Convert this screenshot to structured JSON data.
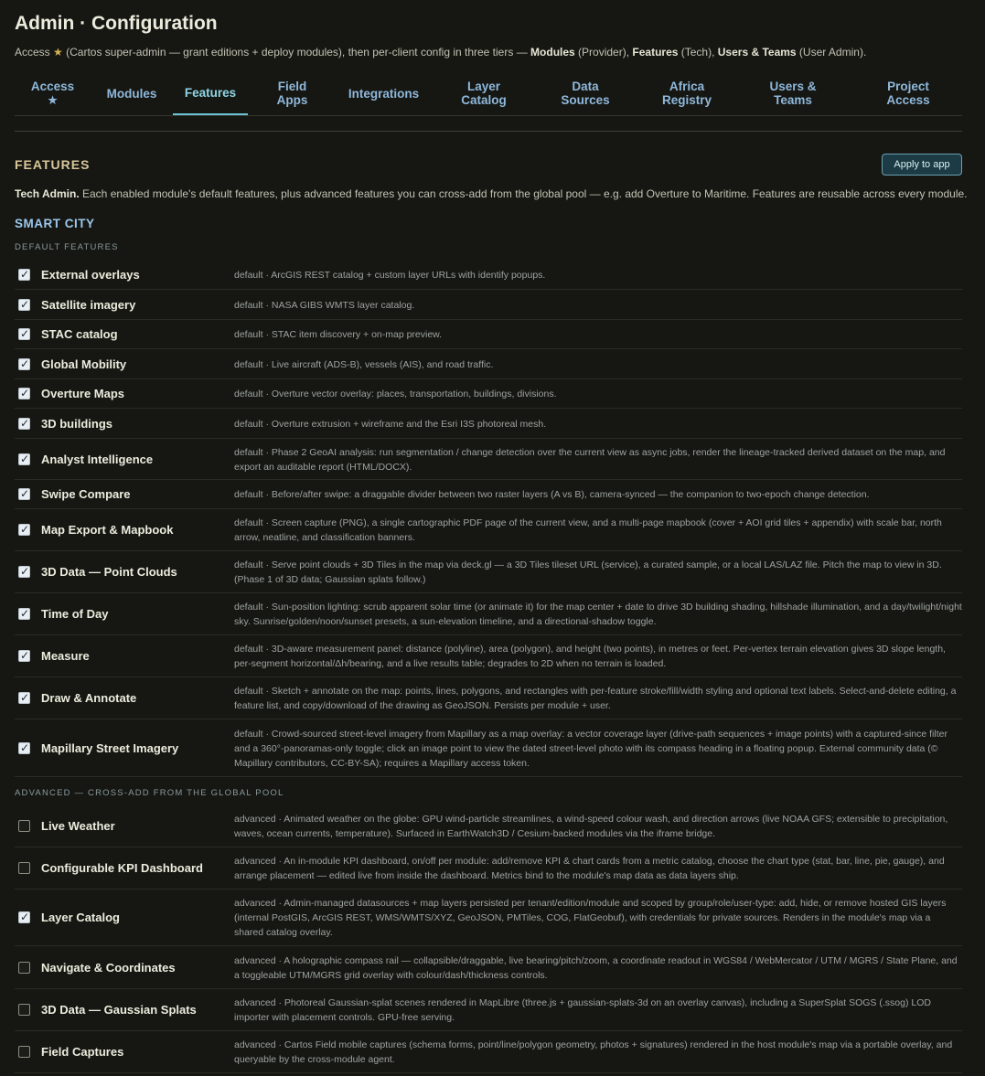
{
  "header": {
    "title": "Admin · Configuration",
    "subtitle_parts": [
      "Access ",
      "★",
      " (Cartos super-admin — grant editions + deploy modules), then per-client config in three tiers — ",
      "Modules",
      " (Provider), ",
      "Features",
      " (Tech), ",
      "Users & Teams",
      " (User Admin)."
    ]
  },
  "tabs": [
    {
      "label": "Access\n★",
      "active": false
    },
    {
      "label": "Modules",
      "active": false
    },
    {
      "label": "Features",
      "active": true
    },
    {
      "label": "Field\nApps",
      "active": false
    },
    {
      "label": "Integrations",
      "active": false
    },
    {
      "label": "Layer\nCatalog",
      "active": false
    },
    {
      "label": "Data\nSources",
      "active": false
    },
    {
      "label": "Africa\nRegistry",
      "active": false
    },
    {
      "label": "Users &\nTeams",
      "active": false
    },
    {
      "label": "Project\nAccess",
      "active": false
    }
  ],
  "section": {
    "title": "FEATURES",
    "apply_label": "Apply to app",
    "intro_bold": "Tech Admin.",
    "intro_text": " Each enabled module's default features, plus advanced features you can cross-add from the global pool — e.g. add Overture to Maritime. Features are reusable across every module."
  },
  "module": {
    "title": "SMART CITY",
    "default_label": "DEFAULT FEATURES",
    "advanced_label": "ADVANCED — CROSS-ADD FROM THE GLOBAL POOL"
  },
  "default_features": [
    {
      "name": "External overlays",
      "checked": true,
      "desc": "default · ArcGIS REST catalog + custom layer URLs with identify popups."
    },
    {
      "name": "Satellite imagery",
      "checked": true,
      "desc": "default · NASA GIBS WMTS layer catalog."
    },
    {
      "name": "STAC catalog",
      "checked": true,
      "desc": "default · STAC item discovery + on-map preview."
    },
    {
      "name": "Global Mobility",
      "checked": true,
      "desc": "default · Live aircraft (ADS-B), vessels (AIS), and road traffic."
    },
    {
      "name": "Overture Maps",
      "checked": true,
      "desc": "default · Overture vector overlay: places, transportation, buildings, divisions."
    },
    {
      "name": "3D buildings",
      "checked": true,
      "desc": "default · Overture extrusion + wireframe and the Esri I3S photoreal mesh."
    },
    {
      "name": "Analyst Intelligence",
      "checked": true,
      "desc": "default · Phase 2 GeoAI analysis: run segmentation / change detection over the current view as async jobs, render the lineage-tracked derived dataset on the map, and export an auditable report (HTML/DOCX)."
    },
    {
      "name": "Swipe Compare",
      "checked": true,
      "desc": "default · Before/after swipe: a draggable divider between two raster layers (A vs B), camera-synced — the companion to two-epoch change detection."
    },
    {
      "name": "Map Export & Mapbook",
      "checked": true,
      "desc": "default · Screen capture (PNG), a single cartographic PDF page of the current view, and a multi-page mapbook (cover + AOI grid tiles + appendix) with scale bar, north arrow, neatline, and classification banners."
    },
    {
      "name": "3D Data — Point Clouds",
      "checked": true,
      "desc": "default · Serve point clouds + 3D Tiles in the map via deck.gl — a 3D Tiles tileset URL (service), a curated sample, or a local LAS/LAZ file. Pitch the map to view in 3D. (Phase 1 of 3D data; Gaussian splats follow.)"
    },
    {
      "name": "Time of Day",
      "checked": true,
      "desc": "default · Sun-position lighting: scrub apparent solar time (or animate it) for the map center + date to drive 3D building shading, hillshade illumination, and a day/twilight/night sky. Sunrise/golden/noon/sunset presets, a sun-elevation timeline, and a directional-shadow toggle."
    },
    {
      "name": "Measure",
      "checked": true,
      "desc": "default · 3D-aware measurement panel: distance (polyline), area (polygon), and height (two points), in metres or feet. Per-vertex terrain elevation gives 3D slope length, per-segment horizontal/Δh/bearing, and a live results table; degrades to 2D when no terrain is loaded."
    },
    {
      "name": "Draw & Annotate",
      "checked": true,
      "desc": "default · Sketch + annotate on the map: points, lines, polygons, and rectangles with per-feature stroke/fill/width styling and optional text labels. Select-and-delete editing, a feature list, and copy/download of the drawing as GeoJSON. Persists per module + user."
    },
    {
      "name": "Mapillary Street Imagery",
      "checked": true,
      "desc": "default · Crowd-sourced street-level imagery from Mapillary as a map overlay: a vector coverage layer (drive-path sequences + image points) with a captured-since filter and a 360°-panoramas-only toggle; click an image point to view the dated street-level photo with its compass heading in a floating popup. External community data (© Mapillary contributors, CC-BY-SA); requires a Mapillary access token."
    }
  ],
  "advanced_features": [
    {
      "name": "Live Weather",
      "checked": false,
      "desc": "advanced · Animated weather on the globe: GPU wind-particle streamlines, a wind-speed colour wash, and direction arrows (live NOAA GFS; extensible to precipitation, waves, ocean currents, temperature). Surfaced in EarthWatch3D / Cesium-backed modules via the iframe bridge."
    },
    {
      "name": "Configurable KPI Dashboard",
      "checked": false,
      "desc": "advanced · An in-module KPI dashboard, on/off per module: add/remove KPI & chart cards from a metric catalog, choose the chart type (stat, bar, line, pie, gauge), and arrange placement — edited live from inside the dashboard. Metrics bind to the module's map data as data layers ship."
    },
    {
      "name": "Layer Catalog",
      "checked": true,
      "desc": "advanced · Admin-managed datasources + map layers persisted per tenant/edition/module and scoped by group/role/user-type: add, hide, or remove hosted GIS layers (internal PostGIS, ArcGIS REST, WMS/WMTS/XYZ, GeoJSON, PMTiles, COG, FlatGeobuf), with credentials for private sources. Renders in the module's map via a shared catalog overlay."
    },
    {
      "name": "Navigate & Coordinates",
      "checked": false,
      "desc": "advanced · A holographic compass rail — collapsible/draggable, live bearing/pitch/zoom, a coordinate readout in WGS84 / WebMercator / UTM / MGRS / State Plane, and a toggleable UTM/MGRS grid overlay with colour/dash/thickness controls."
    },
    {
      "name": "3D Data — Gaussian Splats",
      "checked": false,
      "desc": "advanced · Photoreal Gaussian-splat scenes rendered in MapLibre (three.js + gaussian-splats-3d on an overlay canvas), including a SuperSplat SOGS (.ssog) LOD importer with placement controls. GPU-free serving."
    },
    {
      "name": "Field Captures",
      "checked": false,
      "desc": "advanced · Cartos Field mobile captures (schema forms, point/line/polygon geometry, photos + signatures) rendered in the host module's map via a portable overlay, and queryable by the cross-module agent."
    }
  ]
}
